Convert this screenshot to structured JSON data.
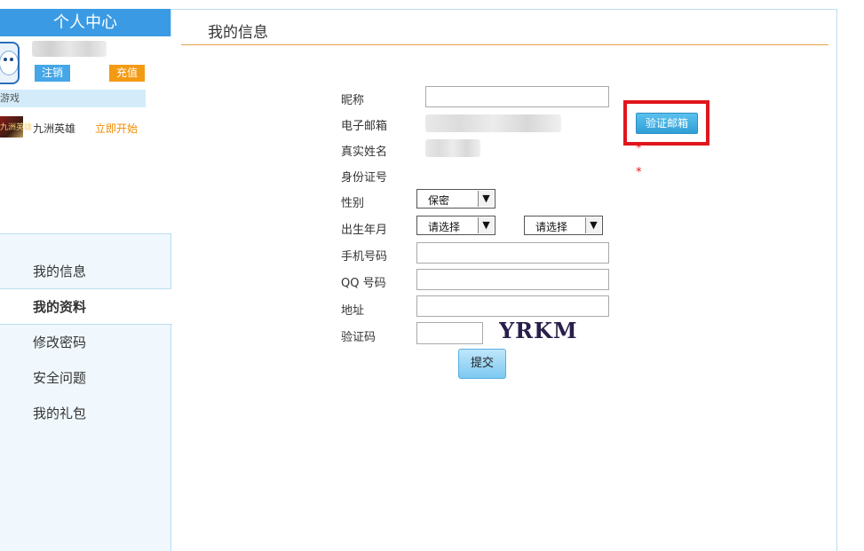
{
  "sidebar": {
    "header": "个人中心",
    "logout_label": "注销",
    "recharge_label": "充值",
    "games_bar_label": "游戏",
    "game": {
      "name": "九洲英雄",
      "start_label": "立即开始",
      "thumb_text": "九洲英雄"
    },
    "menu": [
      {
        "label": "我的信息"
      },
      {
        "label": "我的资料"
      },
      {
        "label": "修改密码"
      },
      {
        "label": "安全问题"
      },
      {
        "label": "我的礼包"
      }
    ]
  },
  "main": {
    "title": "我的信息",
    "form": {
      "nickname_label": "昵称",
      "nickname_value": "",
      "email_label": "电子邮箱",
      "verify_email_label": "验证邮箱",
      "realname_label": "真实姓名",
      "idcard_label": "身份证号",
      "required_mark": "*",
      "gender_label": "性别",
      "gender_value": "保密",
      "birth_label": "出生年月",
      "birth_year_value": "请选择",
      "birth_month_value": "请选择",
      "phone_label": "手机号码",
      "qq_label": "QQ 号码",
      "address_label": "地址",
      "captcha_label": "验证码",
      "captcha_text": "YRKM",
      "submit_label": "提交"
    }
  },
  "colors": {
    "header_blue": "#3a9be4",
    "logout_blue": "#45a6e8",
    "recharge_orange": "#f39a14",
    "title_rule": "#e6a64a",
    "highlight_red": "#e0161d"
  }
}
